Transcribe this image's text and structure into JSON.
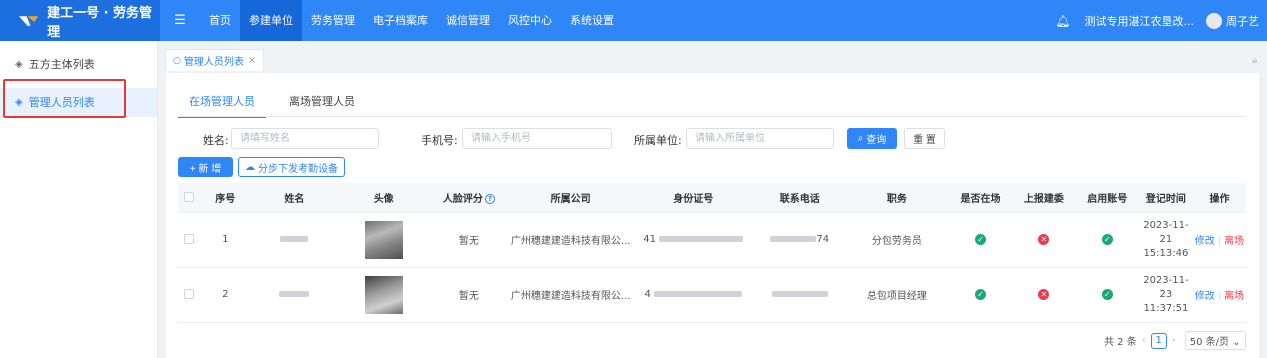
{
  "header": {
    "brand": "建工一号 · 劳务管理",
    "menu_icon": "menu-fold-icon",
    "nav": [
      "首页",
      "参建单位",
      "劳务管理",
      "电子档案库",
      "诚信管理",
      "风控中心",
      "系统设置"
    ],
    "active_nav_index": 1,
    "org_name": "测试专用湛江农垦改...",
    "user_name": "周子艺"
  },
  "sidebar": {
    "items": [
      {
        "label": "五方主体列表",
        "icon": "layers-icon"
      },
      {
        "label": "管理人员列表",
        "icon": "layers-icon"
      }
    ],
    "active_index": 1
  },
  "page_tab": {
    "label": "管理人员列表",
    "close": "×"
  },
  "subtabs": [
    "在场管理人员",
    "离场管理人员"
  ],
  "filters": {
    "name_label": "姓名:",
    "name_placeholder": "请填写姓名",
    "phone_label": "手机号:",
    "phone_placeholder": "请输入手机号",
    "unit_label": "所属单位:",
    "unit_placeholder": "请输入所属单位",
    "search_label": "查询",
    "reset_label": "重 置"
  },
  "actions": {
    "add_label": "+ 新 增",
    "sync_label": "分步下发考勤设备"
  },
  "table": {
    "columns": [
      "序号",
      "姓名",
      "头像",
      "人脸评分",
      "所属公司",
      "身份证号",
      "联系电话",
      "职务",
      "是否在场",
      "上报建委",
      "启用账号",
      "登记时间",
      "操作"
    ],
    "rows": [
      {
        "index": "1",
        "score": "暂无",
        "company": "广州穗建建造科技有限公...",
        "id_prefix": "41",
        "phone_suffix": "74",
        "position": "分包劳务员",
        "on_site": "yes",
        "reported": "no",
        "account": "yes",
        "date": "2023-11-21",
        "time": "15:13:46"
      },
      {
        "index": "2",
        "score": "暂无",
        "company": "广州穗建建造科技有限公...",
        "id_prefix": "4",
        "phone_suffix": "",
        "position": "总包项目经理",
        "on_site": "yes",
        "reported": "no",
        "account": "yes",
        "date": "2023-11-23",
        "time": "11:37:51"
      }
    ],
    "edit_label": "修改",
    "leave_label": "离场"
  },
  "pagination": {
    "total": "共 2 条",
    "page": "1",
    "page_size": "50 条/页"
  }
}
